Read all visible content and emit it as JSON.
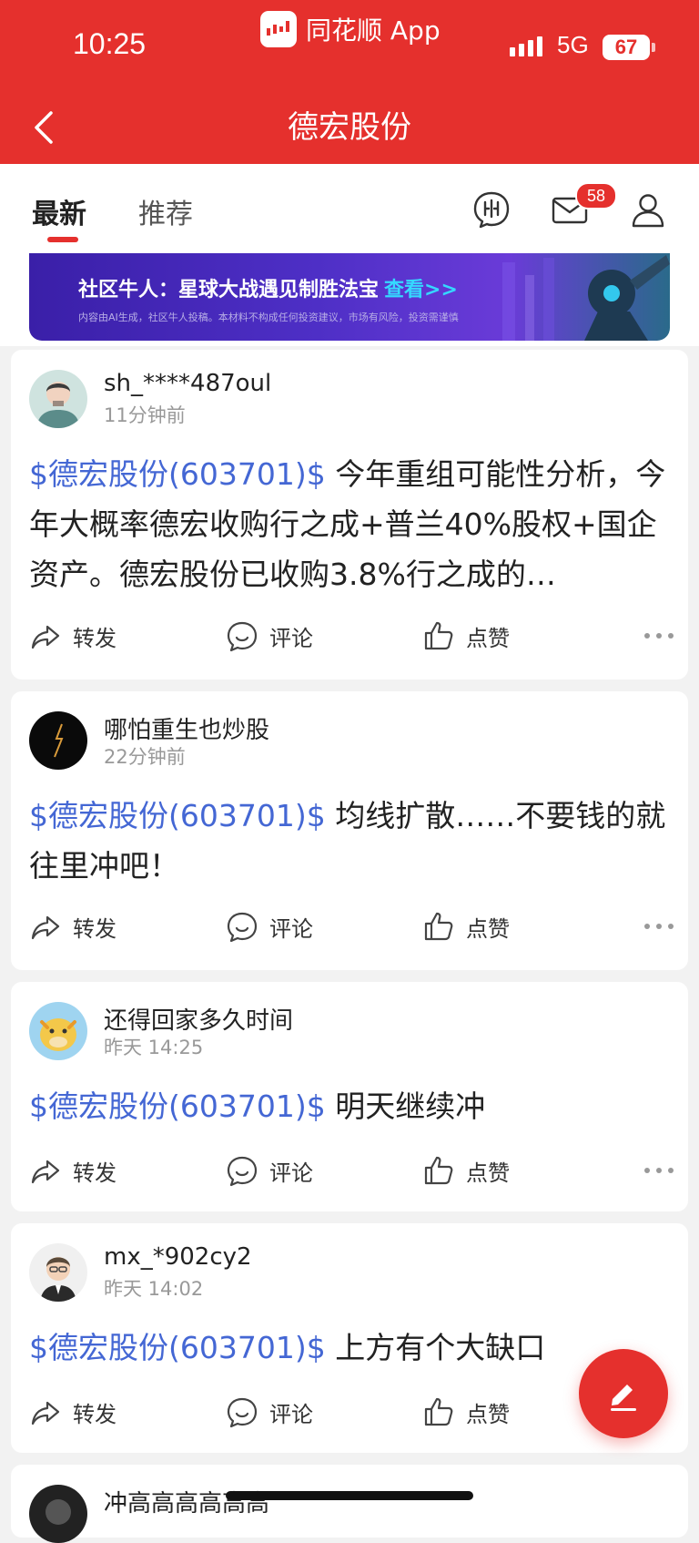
{
  "status": {
    "time": "10:25",
    "network": "5G",
    "battery": "67",
    "app_name": "同花顺 App"
  },
  "header": {
    "title": "德宏股份"
  },
  "tabs": [
    {
      "label": "最新"
    },
    {
      "label": "推荐"
    }
  ],
  "mail_badge": "58",
  "banner": {
    "text": "社区牛人：星球大战遇见制胜法宝",
    "link": "查看>>",
    "disclaimer": "内容由AI生成，社区牛人投稿。本材料不构成任何投资建议，市场有风险，投资需谨慎"
  },
  "actions": {
    "forward": "转发",
    "comment": "评论",
    "like": "点赞"
  },
  "posts": [
    {
      "user": "sh_****487oul",
      "time": "11分钟前",
      "tag": "$德宏股份(603701)$",
      "text": " 今年重组可能性分析，今年大概率德宏收购行之成+普兰40%股权+国企资产。德宏股份已收购3.8%行之成的…"
    },
    {
      "user": "哪怕重生也炒股",
      "time": "22分钟前",
      "tag": "$德宏股份(603701)$",
      "text": " 均线扩散……不要钱的就往里冲吧！"
    },
    {
      "user": "还得回家多久时间",
      "time": "昨天 14:25",
      "tag": "$德宏股份(603701)$",
      "text": " 明天继续冲"
    },
    {
      "user": "mx_*902cy2",
      "time": "昨天 14:02",
      "tag": "$德宏股份(603701)$",
      "text": " 上方有个大缺口"
    },
    {
      "user": "冲高高高高高高",
      "time": "",
      "tag": "",
      "text": ""
    }
  ],
  "colors": {
    "brand_red": "#e5302d",
    "tag_blue": "#4467d4"
  }
}
